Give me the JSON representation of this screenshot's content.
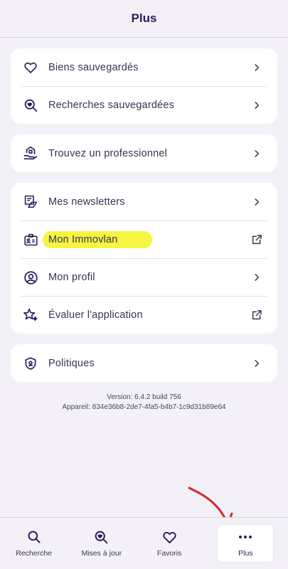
{
  "header": {
    "title": "Plus"
  },
  "groups": [
    {
      "items": [
        {
          "label": "Biens sauvegardés",
          "icon": "heart-icon",
          "trail": "chevron-right"
        },
        {
          "label": "Recherches sauvegardées",
          "icon": "search-heart-icon",
          "trail": "chevron-right"
        }
      ]
    },
    {
      "items": [
        {
          "label": "Trouvez un professionnel",
          "icon": "house-hand-icon",
          "trail": "chevron-right"
        }
      ]
    },
    {
      "items": [
        {
          "label": "Mes newsletters",
          "icon": "newsletter-icon",
          "trail": "chevron-right"
        },
        {
          "label": "Mon Immovlan",
          "icon": "id-card-icon",
          "trail": "external-link",
          "highlighted": true
        },
        {
          "label": "Mon profil",
          "icon": "user-circle-icon",
          "trail": "chevron-right"
        },
        {
          "label": "Évaluer l'application",
          "icon": "star-sparkle-icon",
          "trail": "external-link"
        }
      ]
    },
    {
      "items": [
        {
          "label": "Politiques",
          "icon": "shield-icon",
          "trail": "chevron-right"
        }
      ]
    }
  ],
  "version": {
    "line1": "Version: 6.4.2 build 756",
    "line2": "Appareil: 834e36b8-2de7-4fa5-b4b7-1c9d31b89e64"
  },
  "tabbar": {
    "tabs": [
      {
        "label": "Recherche",
        "icon": "search-icon"
      },
      {
        "label": "Mises à jour",
        "icon": "search-heart-icon"
      },
      {
        "label": "Favoris",
        "icon": "heart-icon"
      },
      {
        "label": "Plus",
        "icon": "more-dots-icon",
        "active": true
      }
    ]
  },
  "colors": {
    "accent": "#2d1a5e",
    "background": "#f3f1f7",
    "highlight": "#f5f542",
    "annotation_arrow": "#d42a2a"
  }
}
